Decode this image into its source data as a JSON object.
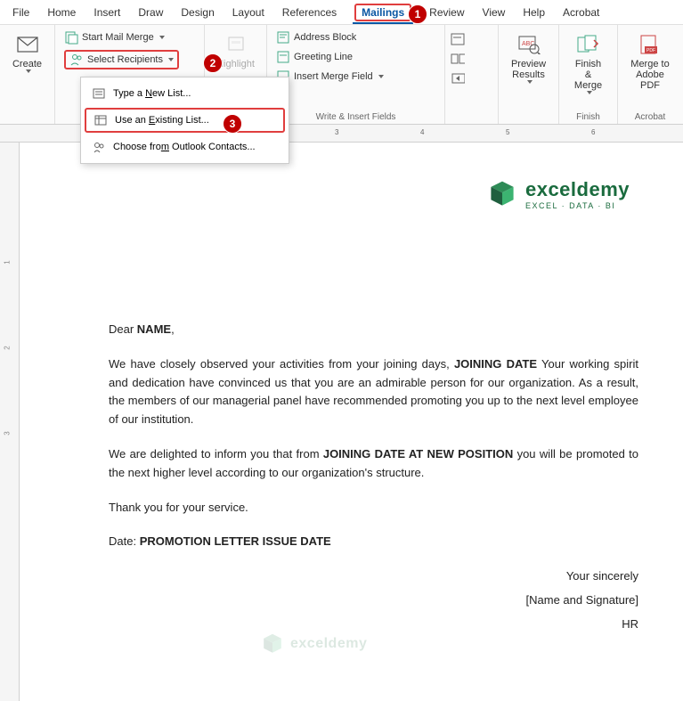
{
  "menu": [
    "File",
    "Home",
    "Insert",
    "Draw",
    "Design",
    "Layout",
    "References",
    "Mailings",
    "Review",
    "View",
    "Help",
    "Acrobat"
  ],
  "menu_active_index": 7,
  "ribbon": {
    "create": "Create",
    "start_mail_merge": "Start Mail Merge",
    "select_recipients": "Select Recipients",
    "highlight": "Highlight",
    "address_block": "Address Block",
    "greeting_line": "Greeting Line",
    "insert_merge_field": "Insert Merge Field",
    "write_insert": "Write & Insert Fields",
    "preview_results": "Preview Results",
    "finish_merge": "Finish & Merge",
    "finish": "Finish",
    "merge_adobe": "Merge to Adobe PDF",
    "acrobat": "Acrobat"
  },
  "dropdown": {
    "type_new": {
      "pre": "Type a ",
      "u": "N",
      "post": "ew List..."
    },
    "use_existing": {
      "pre": "Use an ",
      "u": "E",
      "post": "xisting List..."
    },
    "outlook": {
      "pre": "Choose fro",
      "u": "m",
      "post": " Outlook Contacts..."
    }
  },
  "badges": {
    "b1": "1",
    "b2": "2",
    "b3": "3"
  },
  "ruler_nums": [
    "3",
    "4",
    "5",
    "6"
  ],
  "vruler_nums": [
    "1",
    "2",
    "3"
  ],
  "logo": {
    "text": "exceldemy",
    "sub": "EXCEL · DATA · BI"
  },
  "letter": {
    "greeting_pre": "Dear ",
    "greeting_bold": "NAME",
    "greeting_post": ",",
    "p1_pre": "We have closely observed your activities from your joining days, ",
    "p1_bold": "JOINING DATE",
    "p1_post": " Your working spirit and dedication have convinced us that you are an admirable person for our organization. As a result, the members of our managerial panel have recommended promoting you up to the next level employee of our institution.",
    "p2_pre": "We are delighted to inform you that from ",
    "p2_bold": "JOINING DATE AT NEW POSITION",
    "p2_post": " you will be promoted to the next higher level according to our organization's structure.",
    "thanks": "Thank you for your service.",
    "date_pre": "Date: ",
    "date_bold": "PROMOTION LETTER ISSUE DATE",
    "sig1": "Your sincerely",
    "sig2": "[Name and Signature]",
    "sig3": "HR"
  }
}
